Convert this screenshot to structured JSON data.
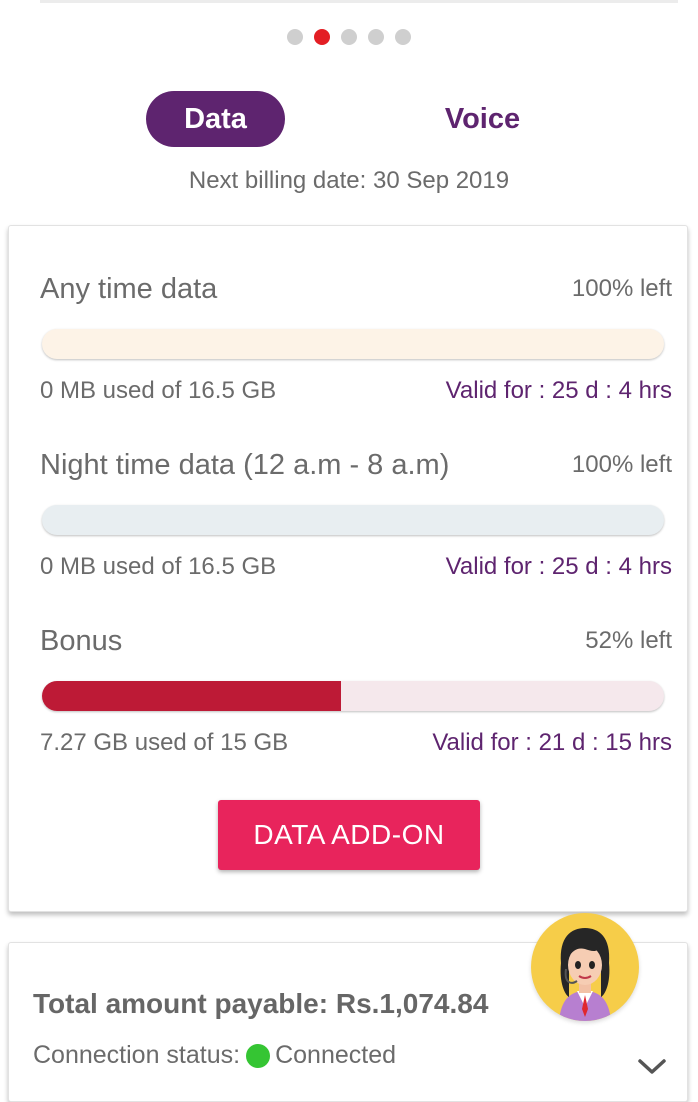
{
  "pager": {
    "count": 5,
    "active_index": 1,
    "active_color": "#e31e24",
    "inactive_color": "#cfcfcf"
  },
  "tabs": [
    {
      "label": "Data",
      "selected": true
    },
    {
      "label": "Voice",
      "selected": false
    }
  ],
  "billing": {
    "next_billing_text": "Next billing date: 30 Sep 2019"
  },
  "usage": [
    {
      "title": "Any time data",
      "left_text": "100% left",
      "used_text": "0 MB used of 16.5 GB",
      "valid_text": "Valid for : 25 d : 4 hrs",
      "used_fraction": 0.0,
      "bar_track_color": "#fdf3e7",
      "bar_fill_color": "#bd1a36"
    },
    {
      "title": "Night time data (12 a.m - 8 a.m)",
      "left_text": "100% left",
      "used_text": "0 MB used of 16.5 GB",
      "valid_text": "Valid for : 25 d : 4 hrs",
      "used_fraction": 0.0,
      "bar_track_color": "#e8eef1",
      "bar_fill_color": "#bd1a36"
    },
    {
      "title": "Bonus",
      "left_text": "52% left",
      "used_text": "7.27 GB used of 15 GB",
      "valid_text": "Valid for : 21 d : 15 hrs",
      "used_fraction": 0.48,
      "bar_track_color": "#f5e8ec",
      "bar_fill_color": "#bd1a36"
    }
  ],
  "actions": {
    "data_addon_label": "DATA ADD-ON"
  },
  "bill_summary": {
    "total_text": "Total amount payable: Rs.1,074.84",
    "connection_label": "Connection status:",
    "connection_value": "Connected",
    "connection_color": "#35c533"
  },
  "assistant": {
    "icon": "assistant-avatar-icon"
  },
  "colors": {
    "brand": "#5e246f",
    "accent": "#e8245c",
    "text": "#6b6b6b"
  }
}
